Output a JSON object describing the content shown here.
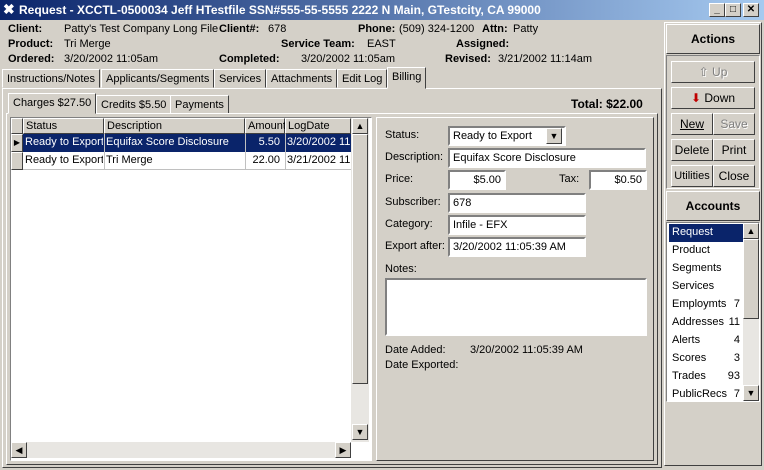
{
  "window": {
    "title": "Request - XCCTL-0500034  Jeff HTestfile  SSN#555-55-5555  2222 N Main, GTestcity, CA 99000",
    "min": "_",
    "max": "□",
    "close": "✕"
  },
  "header": {
    "client_label": "Client:",
    "client": "Patty's Test Company Long File",
    "clientnum_label": "Client#:",
    "clientnum": "678",
    "phone_label": "Phone:",
    "phone": "(509) 324-1200",
    "attn_label": "Attn:",
    "attn": "Patty",
    "product_label": "Product:",
    "product": "Tri Merge",
    "team_label": "Service Team:",
    "team": "EAST",
    "assigned_label": "Assigned:",
    "ordered_label": "Ordered:",
    "ordered": "3/20/2002 11:05am",
    "completed_label": "Completed:",
    "completed": "3/20/2002 11:05am",
    "revised_label": "Revised:",
    "revised": "3/21/2002 11:14am"
  },
  "tabs": [
    "Instructions/Notes",
    "Applicants/Segments",
    "Services",
    "Attachments",
    "Edit Log",
    "Billing"
  ],
  "subtabs": [
    "Charges $27.50",
    "Credits $5.50",
    "Payments"
  ],
  "total": "Total: $22.00",
  "grid": {
    "headers": [
      "Status",
      "Description",
      "Amount",
      "LogDate"
    ],
    "rows": [
      {
        "status": "Ready to Export",
        "desc": "Equifax Score Disclosure",
        "amount": "5.50",
        "date": "3/20/2002 11"
      },
      {
        "status": "Ready to Export",
        "desc": "Tri Merge",
        "amount": "22.00",
        "date": "3/21/2002 11"
      }
    ]
  },
  "detail": {
    "status_label": "Status:",
    "status": "Ready to Export",
    "desc_label": "Description:",
    "desc": "Equifax Score Disclosure",
    "price_label": "Price:",
    "price": "$5.00",
    "tax_label": "Tax:",
    "tax": "$0.50",
    "subscriber_label": "Subscriber:",
    "subscriber": "678",
    "category_label": "Category:",
    "category": "Infile - EFX",
    "export_label": "Export after:",
    "export": "3/20/2002 11:05:39 AM",
    "notes_label": "Notes:",
    "notes": "",
    "added_label": "Date Added:",
    "added": "3/20/2002 11:05:39 AM",
    "exported_label": "Date Exported:",
    "exported": ""
  },
  "actions": {
    "title": "Actions",
    "up": "Up",
    "down": "Down",
    "new": "New",
    "save": "Save",
    "delete": "Delete",
    "print": "Print",
    "utilities": "Utilities",
    "close": "Close"
  },
  "accounts": {
    "title": "Accounts",
    "items": [
      {
        "name": "Request",
        "count": ""
      },
      {
        "name": "Product",
        "count": ""
      },
      {
        "name": "Segments",
        "count": ""
      },
      {
        "name": "Services",
        "count": ""
      },
      {
        "name": "Employmts",
        "count": "7"
      },
      {
        "name": "Addresses",
        "count": "11"
      },
      {
        "name": "Alerts",
        "count": "4"
      },
      {
        "name": "Scores",
        "count": "3"
      },
      {
        "name": "Trades",
        "count": "93"
      },
      {
        "name": "PublicRecs",
        "count": "7"
      }
    ]
  }
}
